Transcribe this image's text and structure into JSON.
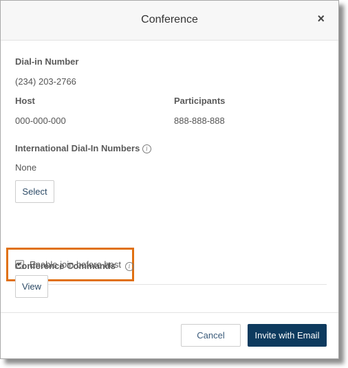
{
  "dialog": {
    "title": "Conference",
    "close_icon": "close-icon"
  },
  "dial_in": {
    "label": "Dial-in Number",
    "value": "(234) 203-2766"
  },
  "host": {
    "label": "Host",
    "value": "000-000-000"
  },
  "participants": {
    "label": "Participants",
    "value": "888-888-888"
  },
  "international": {
    "label": "International Dial-In Numbers",
    "info_icon": "i",
    "value": "None",
    "select_label": "Select"
  },
  "join_before_host": {
    "label": "Enable join before host",
    "checked": true,
    "check_glyph": "✔"
  },
  "commands": {
    "label": "Conference Commands",
    "info_icon": "i",
    "view_label": "View"
  },
  "footer": {
    "cancel_label": "Cancel",
    "invite_label": "Invite with Email"
  },
  "colors": {
    "primary": "#0d3a5e",
    "highlight": "#e07010"
  }
}
